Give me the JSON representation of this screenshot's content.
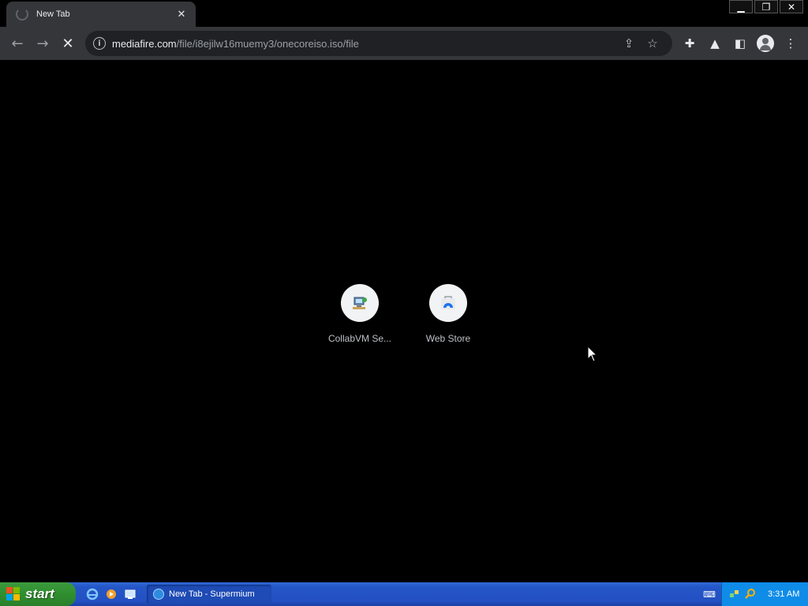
{
  "tab": {
    "title": "New Tab",
    "close": "✕"
  },
  "window_controls": {
    "minimize": "▁",
    "restore": "❐",
    "close": "✕"
  },
  "toolbar": {
    "back": "←",
    "forward": "→",
    "stop": "✕",
    "info": "i",
    "url_host": "mediafire.com",
    "url_path": "/file/i8ejilw16muemy3/onecoreiso.iso/file",
    "share": "⇪",
    "bookmark": "☆",
    "extensions": "✚",
    "labs": "▲",
    "sidepanel": "◧",
    "menu": "⋮"
  },
  "shortcuts": [
    {
      "label": "CollabVM Se..."
    },
    {
      "label": "Web Store"
    }
  ],
  "taskbar": {
    "start_label": "start",
    "task_label": "New Tab - Supermium",
    "clock": "3:31 AM"
  },
  "colors": {
    "chrome_bg": "#35363a",
    "omnibox_bg": "#202124",
    "page_bg": "#000000",
    "taskbar_blue": "#2456c8",
    "start_green": "#2f8f2f",
    "tray_blue": "#0f8ce8"
  }
}
